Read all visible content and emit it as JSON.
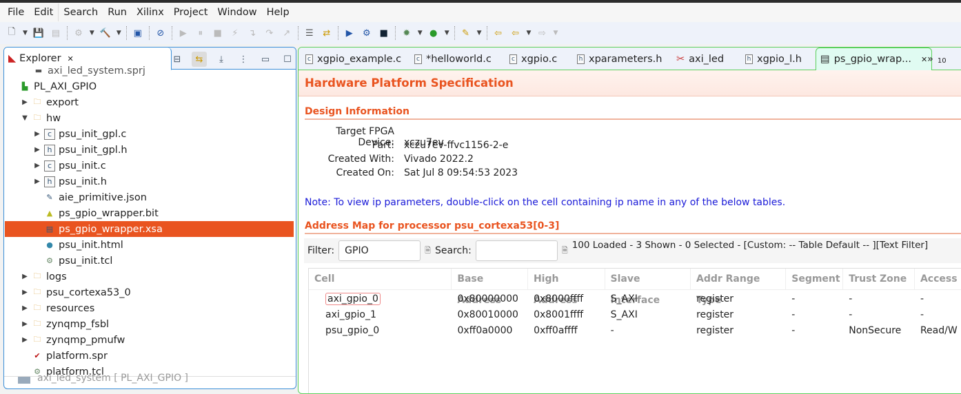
{
  "menu": [
    "File",
    "Edit",
    "Search",
    "Run",
    "Xilinx",
    "Project",
    "Window",
    "Help"
  ],
  "explorer": {
    "tab_label": "Explorer",
    "partial_top": "axi_led_system.sprj",
    "items": [
      {
        "label": "PL_AXI_GPIO",
        "icon": "project-icon",
        "expanded": true
      },
      {
        "label": "export",
        "icon": "folder-icon"
      },
      {
        "label": "hw",
        "icon": "folder-icon",
        "expanded": true
      },
      {
        "label": "psu_init_gpl.c",
        "icon": "c-file-icon"
      },
      {
        "label": "psu_init_gpl.h",
        "icon": "h-file-icon"
      },
      {
        "label": "psu_init.c",
        "icon": "c-file-icon"
      },
      {
        "label": "psu_init.h",
        "icon": "h-file-icon"
      },
      {
        "label": "aie_primitive.json",
        "icon": "json-file-icon"
      },
      {
        "label": "ps_gpio_wrapper.bit",
        "icon": "bitstream-icon"
      },
      {
        "label": "ps_gpio_wrapper.xsa",
        "icon": "xsa-file-icon",
        "selected": true
      },
      {
        "label": "psu_init.html",
        "icon": "html-file-icon"
      },
      {
        "label": "psu_init.tcl",
        "icon": "tcl-file-icon"
      },
      {
        "label": "logs",
        "icon": "folder-icon"
      },
      {
        "label": "psu_cortexa53_0",
        "icon": "folder-icon"
      },
      {
        "label": "resources",
        "icon": "folder-icon"
      },
      {
        "label": "zynqmp_fsbl",
        "icon": "folder-warning-icon"
      },
      {
        "label": "zynqmp_pmufw",
        "icon": "folder-icon"
      },
      {
        "label": "platform.spr",
        "icon": "platform-icon"
      },
      {
        "label": "platform.tcl",
        "icon": "tcl-file-icon"
      }
    ],
    "partial_bottom": "axi_led_system [ PL_AXI_GPIO ]"
  },
  "editor_tabs": [
    "xgpio_example.c",
    "*helloworld.c",
    "xgpio.c",
    "xparameters.h",
    "axi_led",
    "xgpio_l.h",
    "ps_gpio_wrap..."
  ],
  "overflow_count": "10",
  "spec": {
    "title": "Hardware Platform Specification",
    "design_header": "Design Information",
    "design": [
      {
        "k": "Target FPGA Device:",
        "v": "xczu7ev"
      },
      {
        "k": "Part:",
        "v": "xczu7ev-ffvc1156-2-e"
      },
      {
        "k": "Created With:",
        "v": "Vivado 2022.2"
      },
      {
        "k": "Created On:",
        "v": "Sat Jul  8 09:54:53 2023"
      }
    ],
    "note": "Note: To view ip parameters, double-click on the cell containing ip name in any of the below tables.",
    "addr_header": "Address Map for processor psu_cortexa53[0-3]",
    "filter_label": "Filter:",
    "filter_value": "GPIO",
    "search_label": "Search:",
    "search_value": "",
    "status": "100 Loaded - 3 Shown - 0 Selected -  [Custom: -- Table Default -- ][Text Filter]",
    "columns": [
      "Cell",
      "Base Address",
      "High Address",
      "Slave Interface",
      "Addr Range Type",
      "Segment",
      "Trust Zone",
      "Access"
    ],
    "rows": [
      [
        "axi_gpio_0",
        "0x80000000",
        "0x8000ffff",
        "S_AXI",
        "register",
        "-",
        "-",
        "-"
      ],
      [
        "axi_gpio_1",
        "0x80010000",
        "0x8001ffff",
        "S_AXI",
        "register",
        "-",
        "-",
        "-"
      ],
      [
        "psu_gpio_0",
        "0xff0a0000",
        "0xff0affff",
        "-",
        "register",
        "-",
        "NonSecure",
        "Read/W"
      ]
    ]
  },
  "colors": {
    "accent": "#e95420",
    "link": "#1b1bd8",
    "explorer_border": "#3b8fd8",
    "editor_border": "#5ccf5c"
  }
}
